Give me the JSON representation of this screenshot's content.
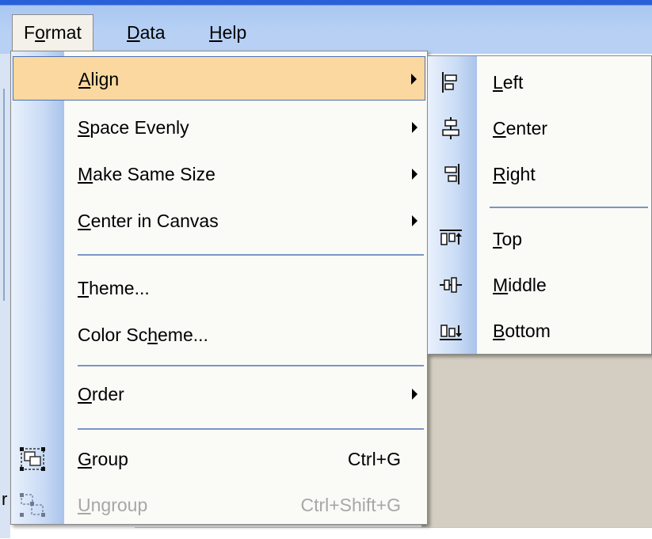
{
  "menubar": {
    "items": [
      {
        "label": "Format",
        "mnemonic_index": 1,
        "open": true
      },
      {
        "label": "Data",
        "mnemonic_index": 0,
        "open": false
      },
      {
        "label": "Help",
        "mnemonic_index": 0,
        "open": false
      }
    ]
  },
  "format_menu": {
    "items": [
      {
        "label": "Align",
        "mnemonic_index": 0,
        "has_submenu": true,
        "highlighted": true
      },
      {
        "label": "Space Evenly",
        "mnemonic_index": 0,
        "has_submenu": true
      },
      {
        "label": "Make Same Size",
        "mnemonic_index": 0,
        "has_submenu": true
      },
      {
        "label": "Center in Canvas",
        "mnemonic_index": 0,
        "has_submenu": true
      },
      {
        "label": "Theme...",
        "mnemonic_index": 0
      },
      {
        "label": "Color Scheme...",
        "mnemonic_index": 8
      },
      {
        "label": "Order",
        "mnemonic_index": 0,
        "has_submenu": true
      },
      {
        "label": "Group",
        "mnemonic_index": 0,
        "shortcut": "Ctrl+G",
        "icon": "group-icon"
      },
      {
        "label": "Ungroup",
        "mnemonic_index": 0,
        "shortcut": "Ctrl+Shift+G",
        "icon": "ungroup-icon",
        "disabled": true
      }
    ]
  },
  "align_submenu": {
    "items": [
      {
        "label": "Left",
        "mnemonic_index": 0,
        "icon": "align-left-icon"
      },
      {
        "label": "Center",
        "mnemonic_index": 0,
        "icon": "align-center-icon"
      },
      {
        "label": "Right",
        "mnemonic_index": 0,
        "icon": "align-right-icon"
      },
      {
        "label": "Top",
        "mnemonic_index": 0,
        "icon": "align-top-icon"
      },
      {
        "label": "Middle",
        "mnemonic_index": 0,
        "icon": "align-middle-icon"
      },
      {
        "label": "Bottom",
        "mnemonic_index": 0,
        "icon": "align-bottom-icon"
      }
    ]
  },
  "background": {
    "partial_text": "r"
  },
  "colors": {
    "highlight": "#fbd89f",
    "highlight_border": "#4a70b6",
    "menu_bg": "#fafaf7",
    "separator": "#7b95c4",
    "title_blue": "#2760d8"
  }
}
